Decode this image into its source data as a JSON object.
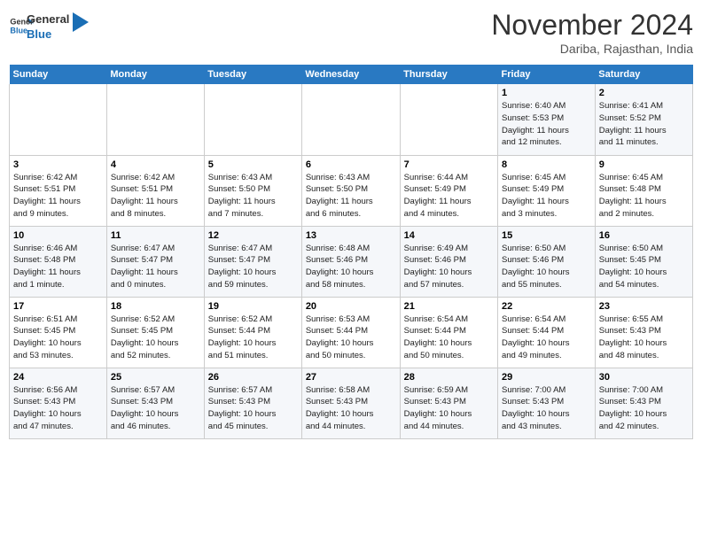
{
  "header": {
    "logo_line1": "General",
    "logo_line2": "Blue",
    "month": "November 2024",
    "location": "Dariba, Rajasthan, India"
  },
  "weekdays": [
    "Sunday",
    "Monday",
    "Tuesday",
    "Wednesday",
    "Thursday",
    "Friday",
    "Saturday"
  ],
  "weeks": [
    [
      {
        "day": "",
        "info": ""
      },
      {
        "day": "",
        "info": ""
      },
      {
        "day": "",
        "info": ""
      },
      {
        "day": "",
        "info": ""
      },
      {
        "day": "",
        "info": ""
      },
      {
        "day": "1",
        "info": "Sunrise: 6:40 AM\nSunset: 5:53 PM\nDaylight: 11 hours\nand 12 minutes."
      },
      {
        "day": "2",
        "info": "Sunrise: 6:41 AM\nSunset: 5:52 PM\nDaylight: 11 hours\nand 11 minutes."
      }
    ],
    [
      {
        "day": "3",
        "info": "Sunrise: 6:42 AM\nSunset: 5:51 PM\nDaylight: 11 hours\nand 9 minutes."
      },
      {
        "day": "4",
        "info": "Sunrise: 6:42 AM\nSunset: 5:51 PM\nDaylight: 11 hours\nand 8 minutes."
      },
      {
        "day": "5",
        "info": "Sunrise: 6:43 AM\nSunset: 5:50 PM\nDaylight: 11 hours\nand 7 minutes."
      },
      {
        "day": "6",
        "info": "Sunrise: 6:43 AM\nSunset: 5:50 PM\nDaylight: 11 hours\nand 6 minutes."
      },
      {
        "day": "7",
        "info": "Sunrise: 6:44 AM\nSunset: 5:49 PM\nDaylight: 11 hours\nand 4 minutes."
      },
      {
        "day": "8",
        "info": "Sunrise: 6:45 AM\nSunset: 5:49 PM\nDaylight: 11 hours\nand 3 minutes."
      },
      {
        "day": "9",
        "info": "Sunrise: 6:45 AM\nSunset: 5:48 PM\nDaylight: 11 hours\nand 2 minutes."
      }
    ],
    [
      {
        "day": "10",
        "info": "Sunrise: 6:46 AM\nSunset: 5:48 PM\nDaylight: 11 hours\nand 1 minute."
      },
      {
        "day": "11",
        "info": "Sunrise: 6:47 AM\nSunset: 5:47 PM\nDaylight: 11 hours\nand 0 minutes."
      },
      {
        "day": "12",
        "info": "Sunrise: 6:47 AM\nSunset: 5:47 PM\nDaylight: 10 hours\nand 59 minutes."
      },
      {
        "day": "13",
        "info": "Sunrise: 6:48 AM\nSunset: 5:46 PM\nDaylight: 10 hours\nand 58 minutes."
      },
      {
        "day": "14",
        "info": "Sunrise: 6:49 AM\nSunset: 5:46 PM\nDaylight: 10 hours\nand 57 minutes."
      },
      {
        "day": "15",
        "info": "Sunrise: 6:50 AM\nSunset: 5:46 PM\nDaylight: 10 hours\nand 55 minutes."
      },
      {
        "day": "16",
        "info": "Sunrise: 6:50 AM\nSunset: 5:45 PM\nDaylight: 10 hours\nand 54 minutes."
      }
    ],
    [
      {
        "day": "17",
        "info": "Sunrise: 6:51 AM\nSunset: 5:45 PM\nDaylight: 10 hours\nand 53 minutes."
      },
      {
        "day": "18",
        "info": "Sunrise: 6:52 AM\nSunset: 5:45 PM\nDaylight: 10 hours\nand 52 minutes."
      },
      {
        "day": "19",
        "info": "Sunrise: 6:52 AM\nSunset: 5:44 PM\nDaylight: 10 hours\nand 51 minutes."
      },
      {
        "day": "20",
        "info": "Sunrise: 6:53 AM\nSunset: 5:44 PM\nDaylight: 10 hours\nand 50 minutes."
      },
      {
        "day": "21",
        "info": "Sunrise: 6:54 AM\nSunset: 5:44 PM\nDaylight: 10 hours\nand 50 minutes."
      },
      {
        "day": "22",
        "info": "Sunrise: 6:54 AM\nSunset: 5:44 PM\nDaylight: 10 hours\nand 49 minutes."
      },
      {
        "day": "23",
        "info": "Sunrise: 6:55 AM\nSunset: 5:43 PM\nDaylight: 10 hours\nand 48 minutes."
      }
    ],
    [
      {
        "day": "24",
        "info": "Sunrise: 6:56 AM\nSunset: 5:43 PM\nDaylight: 10 hours\nand 47 minutes."
      },
      {
        "day": "25",
        "info": "Sunrise: 6:57 AM\nSunset: 5:43 PM\nDaylight: 10 hours\nand 46 minutes."
      },
      {
        "day": "26",
        "info": "Sunrise: 6:57 AM\nSunset: 5:43 PM\nDaylight: 10 hours\nand 45 minutes."
      },
      {
        "day": "27",
        "info": "Sunrise: 6:58 AM\nSunset: 5:43 PM\nDaylight: 10 hours\nand 44 minutes."
      },
      {
        "day": "28",
        "info": "Sunrise: 6:59 AM\nSunset: 5:43 PM\nDaylight: 10 hours\nand 44 minutes."
      },
      {
        "day": "29",
        "info": "Sunrise: 7:00 AM\nSunset: 5:43 PM\nDaylight: 10 hours\nand 43 minutes."
      },
      {
        "day": "30",
        "info": "Sunrise: 7:00 AM\nSunset: 5:43 PM\nDaylight: 10 hours\nand 42 minutes."
      }
    ]
  ]
}
